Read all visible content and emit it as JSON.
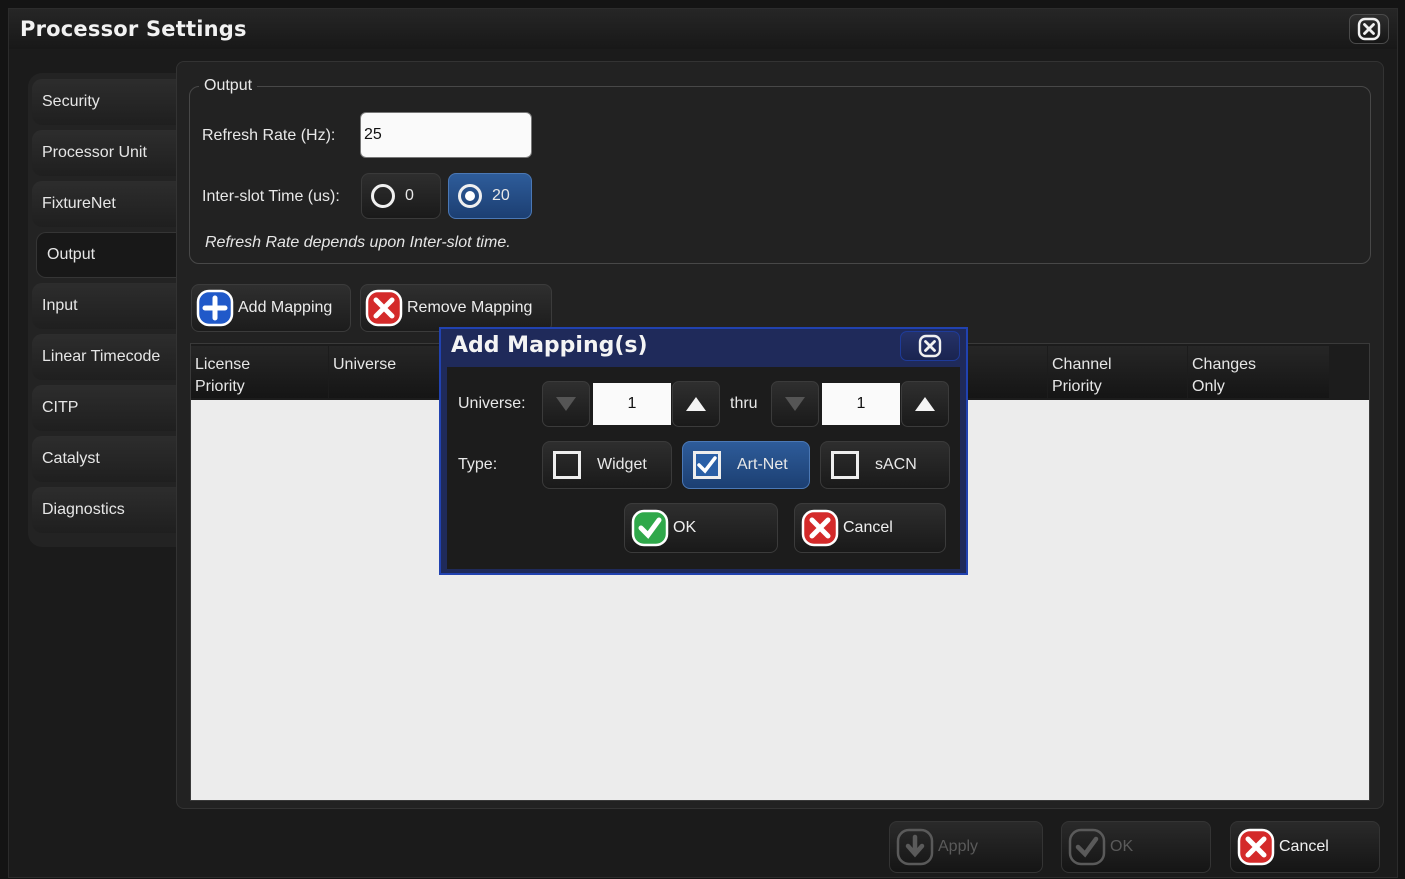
{
  "window": {
    "title": "Processor Settings"
  },
  "tabs": [
    {
      "label": "Security"
    },
    {
      "label": "Processor Unit"
    },
    {
      "label": "FixtureNet"
    },
    {
      "label": "Output",
      "active": true
    },
    {
      "label": "Input"
    },
    {
      "label": "Linear Timecode"
    },
    {
      "label": "CITP"
    },
    {
      "label": "Catalyst"
    },
    {
      "label": "Diagnostics"
    }
  ],
  "output": {
    "group_label": "Output",
    "refresh_rate_label": "Refresh Rate (Hz):",
    "refresh_rate_value": "25",
    "interslot_label": "Inter-slot Time (us):",
    "interslot_options": [
      {
        "label": "0",
        "selected": false
      },
      {
        "label": "20",
        "selected": true
      }
    ],
    "note": "Refresh Rate depends upon Inter-slot time."
  },
  "toolbar": {
    "add_mapping": "Add Mapping",
    "remove_mapping": "Remove Mapping"
  },
  "table": {
    "columns": [
      {
        "line1": "License",
        "line2": "Priority"
      },
      {
        "line1": "Universe",
        "line2": ""
      },
      {
        "line1": "",
        "line2": ""
      },
      {
        "line1": "",
        "line2": ""
      },
      {
        "line1": "",
        "line2": ""
      },
      {
        "line1": "",
        "line2": ""
      },
      {
        "line1": "Channel",
        "line2": "Priority"
      },
      {
        "line1": "Changes",
        "line2": "Only"
      }
    ],
    "rows": []
  },
  "footer": {
    "apply": "Apply",
    "ok": "OK",
    "cancel": "Cancel"
  },
  "dialog": {
    "title": "Add Mapping(s)",
    "universe_label": "Universe:",
    "from_value": "1",
    "thru_label": "thru",
    "thru_value": "1",
    "type_label": "Type:",
    "types": [
      {
        "label": "Widget",
        "checked": false
      },
      {
        "label": "Art-Net",
        "checked": true
      },
      {
        "label": "sACN",
        "checked": false
      }
    ],
    "ok": "OK",
    "cancel": "Cancel"
  },
  "colors": {
    "selected_blue": "#2e5c9a",
    "dialog_border": "#2142b0",
    "ok_green": "#2fa84a",
    "cancel_red": "#d42a2a",
    "add_blue": "#2059c9"
  }
}
